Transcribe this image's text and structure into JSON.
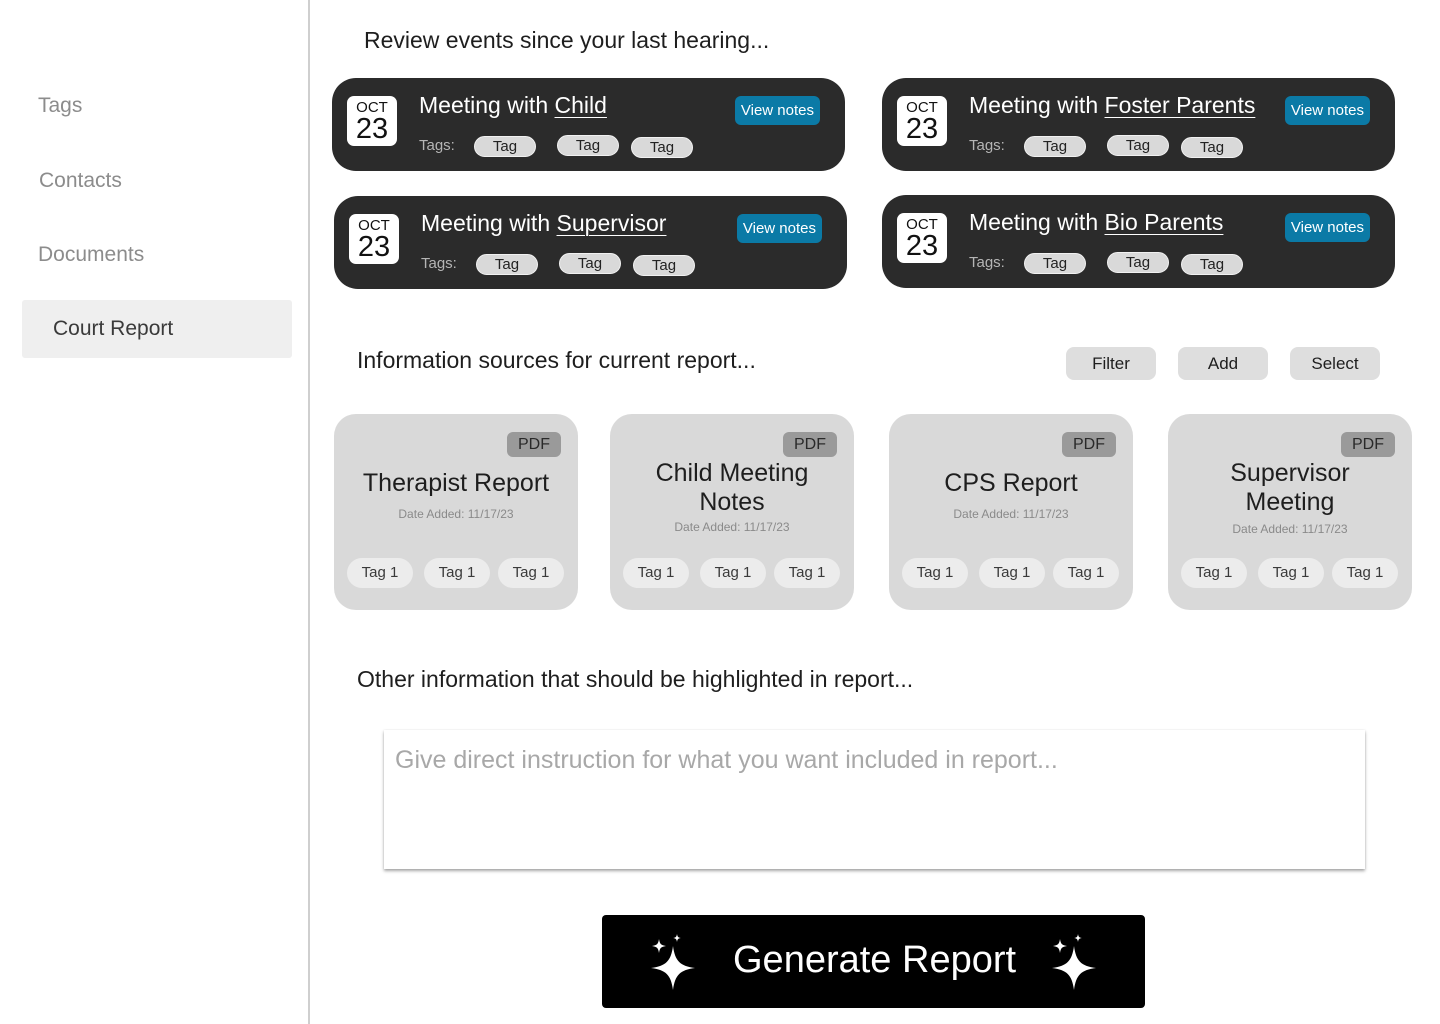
{
  "sidebar": {
    "items": [
      {
        "label": "Tags"
      },
      {
        "label": "Contacts"
      },
      {
        "label": "Documents"
      },
      {
        "label": "Court Report",
        "active": true
      }
    ]
  },
  "events_section": {
    "heading": "Review events since your last hearing...",
    "tags_label": "Tags:",
    "view_notes_label": "View notes",
    "events": [
      {
        "month": "OCT",
        "day": "23",
        "prefix": "Meeting with",
        "who": "Child",
        "tags": [
          "Tag",
          "Tag",
          "Tag"
        ]
      },
      {
        "month": "OCT",
        "day": "23",
        "prefix": "Meeting with",
        "who": "Foster Parents",
        "tags": [
          "Tag",
          "Tag",
          "Tag"
        ]
      },
      {
        "month": "OCT",
        "day": "23",
        "prefix": "Meeting with",
        "who": "Supervisor",
        "tags": [
          "Tag",
          "Tag",
          "Tag"
        ]
      },
      {
        "month": "OCT",
        "day": "23",
        "prefix": "Meeting with",
        "who": "Bio Parents",
        "tags": [
          "Tag",
          "Tag",
          "Tag"
        ]
      }
    ]
  },
  "sources_section": {
    "heading": "Information sources for current report...",
    "actions": {
      "filter": "Filter",
      "add": "Add",
      "select": "Select"
    },
    "sources": [
      {
        "badge": "PDF",
        "title": "Therapist Report",
        "date": "Date Added: 11/17/23",
        "tags": [
          "Tag 1",
          "Tag 1",
          "Tag 1"
        ]
      },
      {
        "badge": "PDF",
        "title": "Child Meeting Notes",
        "date": "Date Added: 11/17/23",
        "tags": [
          "Tag 1",
          "Tag 1",
          "Tag 1"
        ]
      },
      {
        "badge": "PDF",
        "title": "CPS Report",
        "date": "Date Added: 11/17/23",
        "tags": [
          "Tag 1",
          "Tag 1",
          "Tag 1"
        ]
      },
      {
        "badge": "PDF",
        "title": "Supervisor Meeting",
        "date": "Date Added: 11/17/23",
        "tags": [
          "Tag 1",
          "Tag 1",
          "Tag 1"
        ]
      }
    ]
  },
  "highlight_section": {
    "heading": "Other information that should be highlighted in report...",
    "placeholder": "Give direct instruction for what you want included in report...",
    "value": ""
  },
  "generate": {
    "label": "Generate Report",
    "icon": "sparkle-icon"
  }
}
